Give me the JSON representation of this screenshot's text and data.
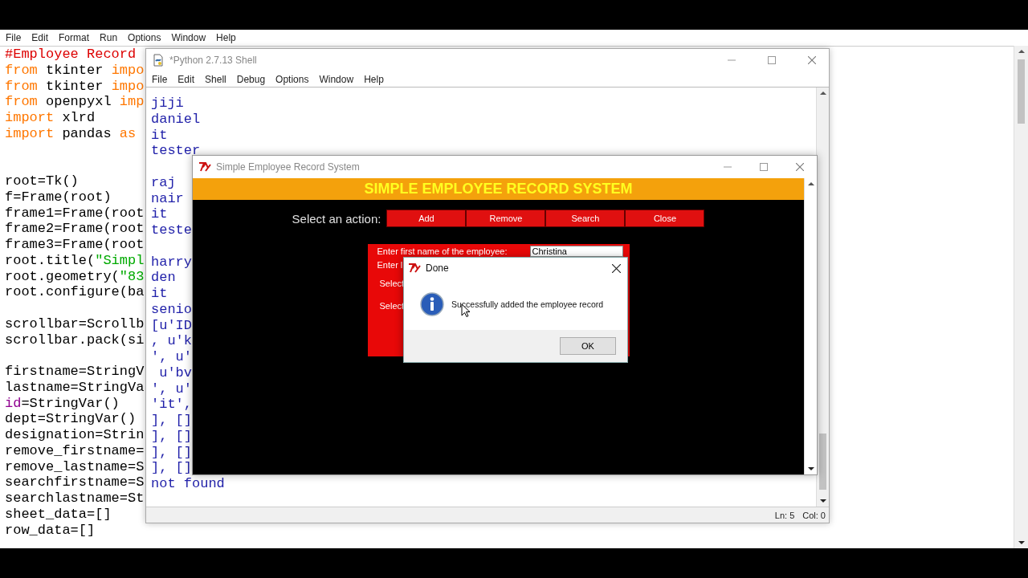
{
  "editor": {
    "menu": [
      "File",
      "Edit",
      "Format",
      "Run",
      "Options",
      "Window",
      "Help"
    ],
    "code_blocks": [
      [
        {
          "tokens": [
            {
              "text": "#Employee Record",
              "kind": "comment"
            }
          ]
        },
        {
          "tokens": [
            {
              "text": "from",
              "kind": "keyword"
            },
            {
              "text": " tkinter ",
              "kind": "plain"
            },
            {
              "text": "impo",
              "kind": "keyword"
            }
          ]
        },
        {
          "tokens": [
            {
              "text": "from",
              "kind": "keyword"
            },
            {
              "text": " tkinter ",
              "kind": "plain"
            },
            {
              "text": "impo",
              "kind": "keyword"
            }
          ]
        },
        {
          "tokens": [
            {
              "text": "from",
              "kind": "keyword"
            },
            {
              "text": " openpyxl ",
              "kind": "plain"
            },
            {
              "text": "imp",
              "kind": "keyword"
            }
          ]
        },
        {
          "tokens": [
            {
              "text": "import",
              "kind": "keyword"
            },
            {
              "text": " xlrd",
              "kind": "plain"
            }
          ]
        },
        {
          "tokens": [
            {
              "text": "import",
              "kind": "keyword"
            },
            {
              "text": " pandas ",
              "kind": "plain"
            },
            {
              "text": "as",
              "kind": "keyword"
            }
          ]
        }
      ],
      [
        {
          "tokens": [
            {
              "text": "root=Tk()",
              "kind": "plain"
            }
          ]
        },
        {
          "tokens": [
            {
              "text": "f=Frame(root)",
              "kind": "plain"
            }
          ]
        },
        {
          "tokens": [
            {
              "text": "frame1=Frame(root",
              "kind": "plain"
            }
          ]
        },
        {
          "tokens": [
            {
              "text": "frame2=Frame(root",
              "kind": "plain"
            }
          ]
        },
        {
          "tokens": [
            {
              "text": "frame3=Frame(root",
              "kind": "plain"
            }
          ]
        },
        {
          "tokens": [
            {
              "text": "root.title(",
              "kind": "plain"
            },
            {
              "text": "\"Simpl",
              "kind": "string"
            }
          ]
        },
        {
          "tokens": [
            {
              "text": "root.geometry(",
              "kind": "plain"
            },
            {
              "text": "\"83",
              "kind": "string"
            }
          ]
        },
        {
          "tokens": [
            {
              "text": "root.configure(ba",
              "kind": "plain"
            }
          ]
        }
      ],
      [
        {
          "tokens": [
            {
              "text": "scrollbar=Scrollb",
              "kind": "plain"
            }
          ]
        },
        {
          "tokens": [
            {
              "text": "scrollbar.pack(si",
              "kind": "plain"
            }
          ]
        }
      ],
      [
        {
          "tokens": [
            {
              "text": "firstname=StringV",
              "kind": "plain"
            }
          ]
        },
        {
          "tokens": [
            {
              "text": "lastname=StringVa",
              "kind": "plain"
            }
          ]
        },
        {
          "tokens": [
            {
              "text": "id",
              "kind": "builtin"
            },
            {
              "text": "=StringVar()",
              "kind": "plain"
            }
          ]
        },
        {
          "tokens": [
            {
              "text": "dept=StringVar()",
              "kind": "plain"
            }
          ]
        },
        {
          "tokens": [
            {
              "text": "designation=Strin",
              "kind": "plain"
            }
          ]
        },
        {
          "tokens": [
            {
              "text": "remove_firstname=",
              "kind": "plain"
            }
          ]
        },
        {
          "tokens": [
            {
              "text": "remove_lastname=S",
              "kind": "plain"
            }
          ]
        },
        {
          "tokens": [
            {
              "text": "searchfirstname=S",
              "kind": "plain"
            }
          ]
        },
        {
          "tokens": [
            {
              "text": "searchlastname=St",
              "kind": "plain"
            }
          ]
        },
        {
          "tokens": [
            {
              "text": "sheet_data=[]",
              "kind": "plain"
            }
          ]
        },
        {
          "tokens": [
            {
              "text": "row_data=[]",
              "kind": "plain"
            }
          ]
        }
      ]
    ]
  },
  "shell": {
    "title": "*Python 2.7.13 Shell",
    "menu": [
      "File",
      "Edit",
      "Shell",
      "Debug",
      "Options",
      "Window",
      "Help"
    ],
    "output_blocks": [
      [
        "jiji",
        "daniel",
        "it",
        "tester"
      ],
      [
        "raj",
        "nair",
        "it",
        "teste"
      ],
      [
        "harry",
        "den",
        "it",
        "senio",
        "[u'ID",
        ", u'k",
        "', u'",
        " u'bv",
        "', u'",
        "'it',",
        "], []",
        "], []",
        "], []",
        "], []",
        "not found"
      ]
    ],
    "status": {
      "line": "Ln: 5",
      "column": "Col: 0"
    }
  },
  "app_window": {
    "title": "Simple Employee Record System",
    "header": "SIMPLE EMPLOYEE RECORD SYSTEM",
    "action_label": "Select an action:",
    "actions": [
      "Add",
      "Remove",
      "Search",
      "Close"
    ],
    "form": {
      "labels": [
        "Enter first name of the employee:",
        "Enter l",
        "Select",
        "Select"
      ],
      "first_name_value": "Christina"
    }
  },
  "dialog": {
    "title": "Done",
    "message": "Successfully added the employee record",
    "button": "OK"
  }
}
